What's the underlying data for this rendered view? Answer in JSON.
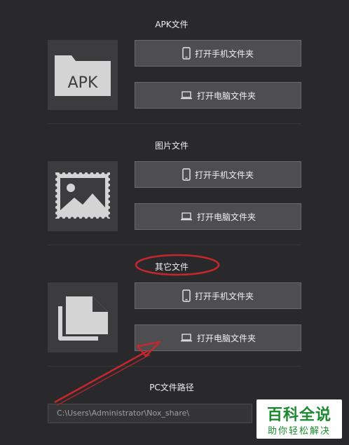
{
  "sections": [
    {
      "title": "APK文件",
      "thumb_label": "APK",
      "icon": "apk-folder-icon",
      "phone_btn": "打开手机文件夹",
      "pc_btn": "打开电脑文件夹"
    },
    {
      "title": "图片文件",
      "icon": "image-icon",
      "phone_btn": "打开手机文件夹",
      "pc_btn": "打开电脑文件夹"
    },
    {
      "title": "其它文件",
      "icon": "documents-icon",
      "phone_btn": "打开手机文件夹",
      "pc_btn": "打开电脑文件夹"
    }
  ],
  "pc_path": {
    "label": "PC文件路径",
    "value": "C:\\Users\\Administrator\\Nox_share\\"
  },
  "watermark": {
    "main": "百科全说",
    "sub": "助你轻松解决"
  },
  "colors": {
    "background": "#29292c",
    "button": "#4e4e51",
    "annotation": "#c4272c",
    "watermark": "#1b8a2e"
  }
}
